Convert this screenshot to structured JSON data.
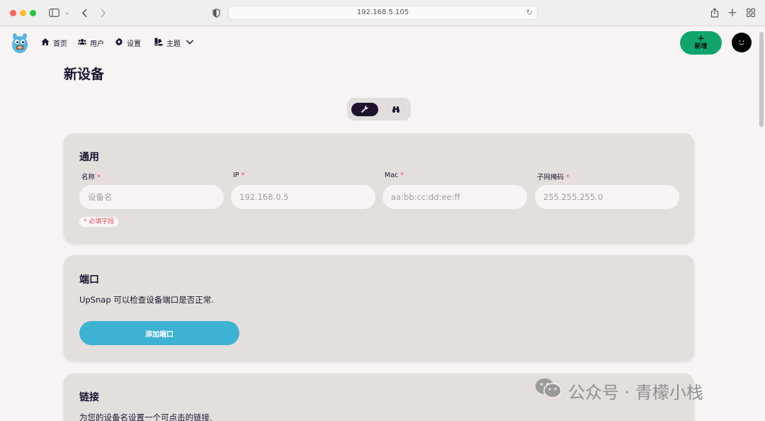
{
  "browser": {
    "url": "192.168.5.105"
  },
  "nav": {
    "items": [
      {
        "label": "首页",
        "icon": "home-icon"
      },
      {
        "label": "用户",
        "icon": "users-icon"
      },
      {
        "label": "设置",
        "icon": "gear-icon"
      },
      {
        "label": "主题",
        "icon": "palette-icon"
      }
    ],
    "add_button": {
      "icon": "+",
      "label": "新增"
    }
  },
  "page": {
    "title": "新设备"
  },
  "view_toggle": {
    "options": [
      "wrench-icon",
      "binoculars-icon"
    ],
    "active": "wrench-icon"
  },
  "general": {
    "title": "通用",
    "fields": [
      {
        "label": "名称",
        "required_mark": "*",
        "placeholder": "设备名"
      },
      {
        "label": "IP",
        "required_mark": "*",
        "placeholder": "192.168.0.5"
      },
      {
        "label": "Mac",
        "required_mark": "*",
        "placeholder": "aa:bb:cc:dd:ee:ff"
      },
      {
        "label": "子网掩码",
        "required_mark": "*",
        "placeholder": "255.255.255.0"
      }
    ],
    "required_note": "* 必填字段"
  },
  "ports": {
    "title": "端口",
    "description": "UpSnap 可以检查设备端口是否正常.",
    "add_button": "添加端口"
  },
  "links": {
    "title": "链接",
    "description": "为您的设备名设置一个可点击的链接."
  },
  "watermark": {
    "text": "公众号 · 青檬小栈"
  },
  "colors": {
    "accent_dark": "#1f1330",
    "success": "#0fa56b",
    "info": "#3eb2d2",
    "error": "#e24f5d"
  }
}
